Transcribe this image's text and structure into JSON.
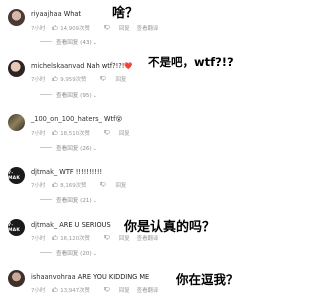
{
  "comments": [
    {
      "username": "riyaajhaa",
      "text": "What",
      "time": "7小时",
      "likes": "14,909次赞",
      "reply": "回复",
      "translate": "查看翻译",
      "replies": "查看回复 (43)",
      "caption": "啥？"
    },
    {
      "username": "michelskaanvad",
      "text": "Nah wtf?!?!❤️",
      "time": "7小时",
      "likes": "9,959次赞",
      "reply": "回复",
      "translate": "",
      "replies": "查看回复 (95)",
      "caption": "不是吧，wtf?!?"
    },
    {
      "username": "_100_on_100_haters_",
      "text": "Wtf😵",
      "time": "7小时",
      "likes": "18,510次赞",
      "reply": "回复",
      "translate": "",
      "replies": "查看回复 (26)",
      "caption": ""
    },
    {
      "username": "djtmak_",
      "text": "WTF !!!!!!!!!!",
      "time": "7小时",
      "likes": "8,169次赞",
      "reply": "回复",
      "translate": "",
      "replies": "查看回复 (21)",
      "caption": "",
      "avatar_text": "7-MAK"
    },
    {
      "username": "djtmak_",
      "text": "ARE U SERIOUS",
      "time": "7小时",
      "likes": "16,120次赞",
      "reply": "回复",
      "translate": "查看翻译",
      "replies": "查看回复 (20)",
      "caption": "你是认真的吗？",
      "avatar_text": "7-MAK"
    },
    {
      "username": "ishaanvohraa",
      "text": "ARE YOU KIDDING ME",
      "time": "7小时",
      "likes": "13,947次赞",
      "reply": "回复",
      "translate": "查看翻译",
      "replies": "",
      "caption": "你在逗我？"
    }
  ]
}
